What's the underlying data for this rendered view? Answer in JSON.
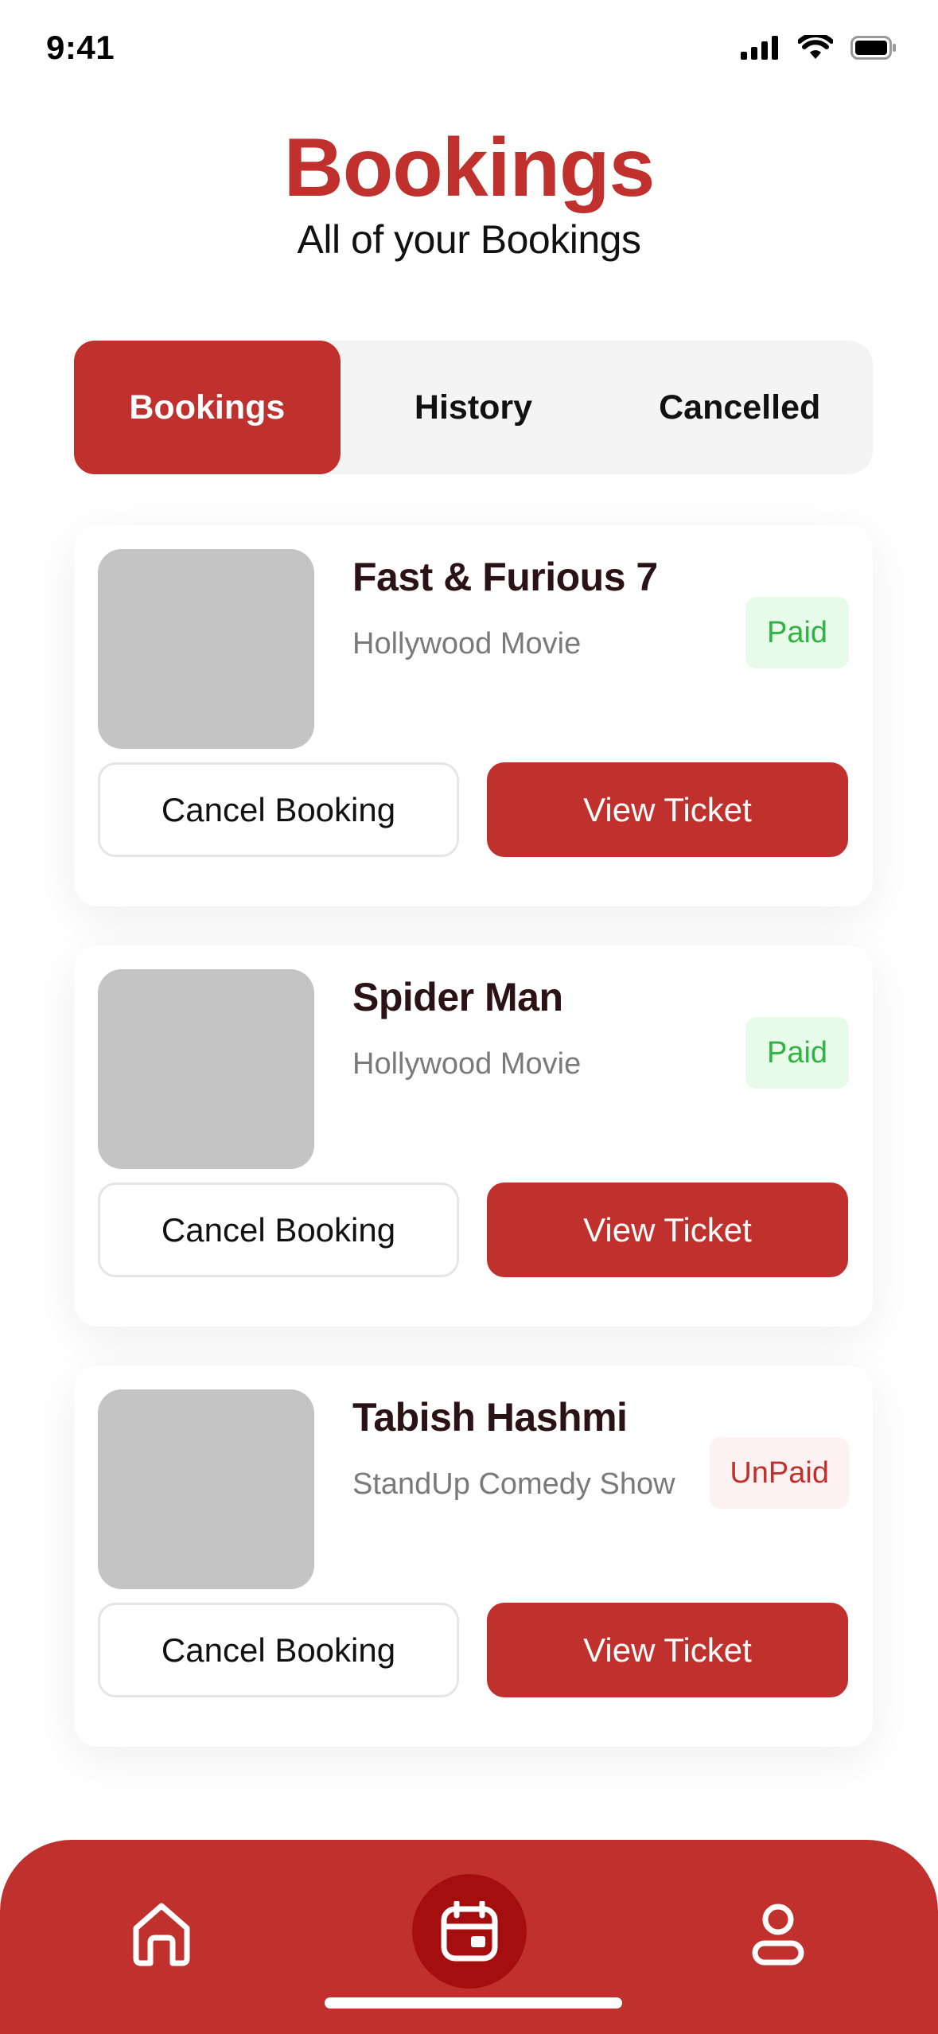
{
  "status_bar": {
    "time": "9:41",
    "icons": [
      "cellular-signal-icon",
      "wifi-icon",
      "battery-icon"
    ]
  },
  "header": {
    "title": "Bookings",
    "subtitle": "All of your Bookings"
  },
  "tabs": [
    {
      "label": "Bookings",
      "active": true
    },
    {
      "label": "History",
      "active": false
    },
    {
      "label": "Cancelled",
      "active": false
    }
  ],
  "bookings": [
    {
      "title": "Fast & Furious 7",
      "category": "Hollywood Movie",
      "status": "Paid",
      "cancel_label": "Cancel Booking",
      "view_label": "View Ticket"
    },
    {
      "title": "Spider Man",
      "category": "Hollywood Movie",
      "status": "Paid",
      "cancel_label": "Cancel Booking",
      "view_label": "View Ticket"
    },
    {
      "title": "Tabish Hashmi",
      "category": "StandUp Comedy Show",
      "status": "UnPaid",
      "cancel_label": "Cancel Booking",
      "view_label": "View Ticket"
    }
  ],
  "bottom_nav": {
    "items": [
      "home-icon",
      "calendar-icon",
      "profile-icon"
    ],
    "active": "calendar-icon"
  },
  "colors": {
    "accent": "#c0312e",
    "accent_dark": "#a50e0e",
    "paid_text": "#2fb344",
    "paid_bg": "#e8fbe8",
    "unpaid_bg": "#fdf1f1",
    "thumb": "#c4c4c4"
  }
}
